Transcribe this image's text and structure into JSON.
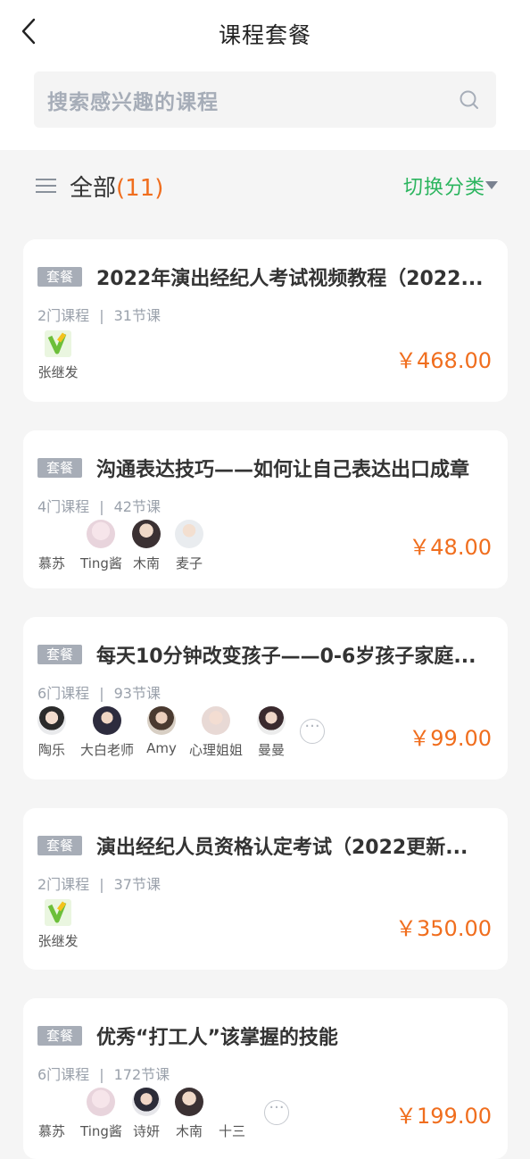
{
  "header": {
    "title": "课程套餐",
    "back_icon": "chevron-left-icon"
  },
  "search": {
    "placeholder": "搜索感兴趣的课程",
    "icon": "search-icon"
  },
  "filter": {
    "label": "全部",
    "count_open": "(",
    "count": "11",
    "count_close": ")",
    "switch_label": "切换分类"
  },
  "colors": {
    "accent_green": "#2cb55f",
    "price_orange": "#f06e1e",
    "tag_gray": "#a7adb7"
  },
  "courses": [
    {
      "tag": "套餐",
      "title": "2022年演出经纪人考试视频教程（2022...",
      "course_count": "2门课程",
      "sep": "|",
      "lesson_count": "31节课",
      "teachers": [
        {
          "name": "张继发"
        }
      ],
      "price": "￥468.00"
    },
    {
      "tag": "套餐",
      "title": "沟通表达技巧——如何让自己表达出口成章",
      "course_count": "4门课程",
      "sep": "|",
      "lesson_count": "42节课",
      "teachers": [
        {
          "name": "慕苏"
        },
        {
          "name": "Ting酱"
        },
        {
          "name": "木南"
        },
        {
          "name": "麦子"
        }
      ],
      "price": "￥48.00"
    },
    {
      "tag": "套餐",
      "title": "每天10分钟改变孩子——0-6岁孩子家庭...",
      "course_count": "6门课程",
      "sep": "|",
      "lesson_count": "93节课",
      "teachers": [
        {
          "name": "陶乐"
        },
        {
          "name": "大白老师"
        },
        {
          "name": "Amy"
        },
        {
          "name": "心理姐姐"
        },
        {
          "name": "曼曼"
        }
      ],
      "more": "···",
      "price": "￥99.00"
    },
    {
      "tag": "套餐",
      "title": "演出经纪人员资格认定考试（2022更新...",
      "course_count": "2门课程",
      "sep": "|",
      "lesson_count": "37节课",
      "teachers": [
        {
          "name": "张继发"
        }
      ],
      "price": "￥350.00"
    },
    {
      "tag": "套餐",
      "title": "优秀“打工人”该掌握的技能",
      "course_count": "6门课程",
      "sep": "|",
      "lesson_count": "172节课",
      "teachers": [
        {
          "name": "慕苏"
        },
        {
          "name": "Ting酱"
        },
        {
          "name": "诗妍"
        },
        {
          "name": "木南"
        },
        {
          "name": "十三"
        }
      ],
      "more": "···",
      "price": "￥199.00"
    }
  ]
}
